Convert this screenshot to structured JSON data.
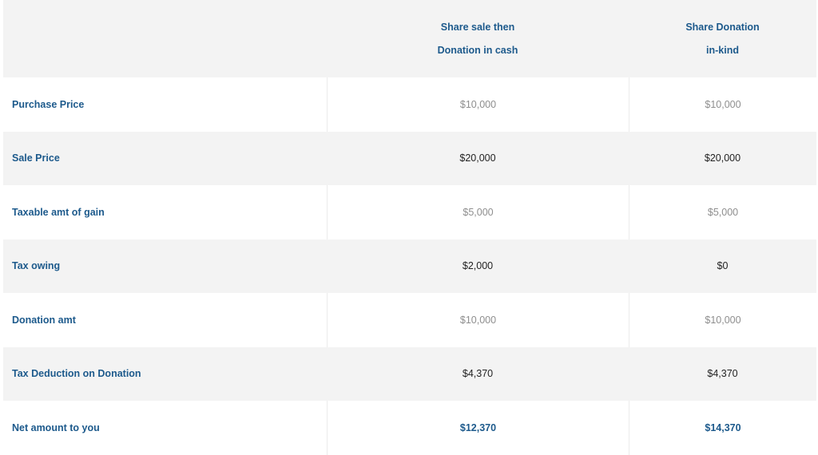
{
  "header": {
    "col_a": [
      "Share sale then",
      "Donation in cash"
    ],
    "col_b": [
      "Share Donation",
      "in-kind"
    ]
  },
  "rows": [
    {
      "label": "Purchase Price",
      "a": "$10,000",
      "b": "$10,000"
    },
    {
      "label": "Sale Price",
      "a": "$20,000",
      "b": "$20,000"
    },
    {
      "label": "Taxable amt of gain",
      "a": "$5,000",
      "b": "$5,000"
    },
    {
      "label": "Tax owing",
      "a": "$2,000",
      "b": "$0"
    },
    {
      "label": "Donation amt",
      "a": "$10,000",
      "b": "$10,000"
    },
    {
      "label": "Tax Deduction on Donation",
      "a": "$4,370",
      "b": "$4,370"
    },
    {
      "label": "Net amount to you",
      "a": "$12,370",
      "b": "$14,370"
    }
  ]
}
